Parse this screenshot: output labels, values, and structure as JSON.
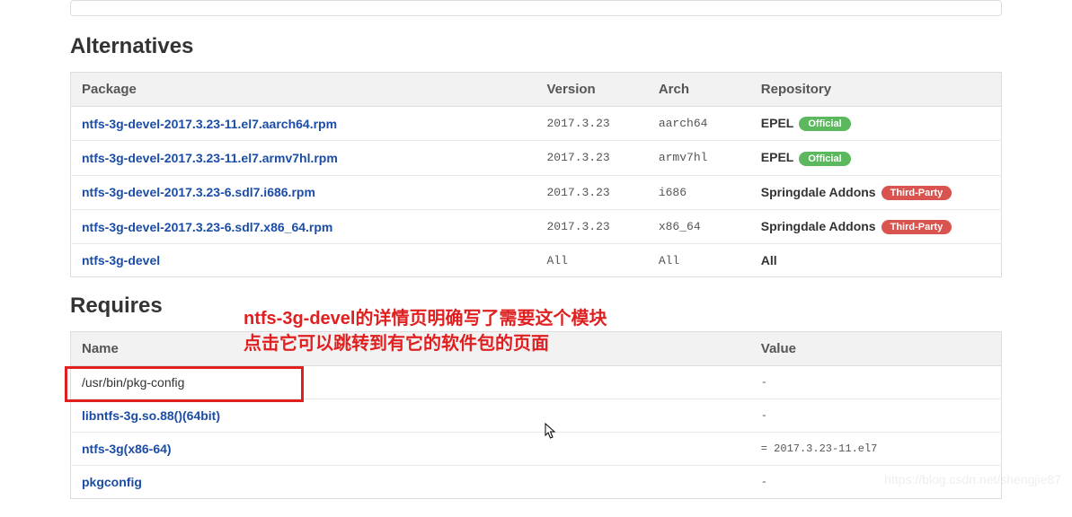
{
  "sections": {
    "alternatives": {
      "heading": "Alternatives",
      "columns": {
        "package": "Package",
        "version": "Version",
        "arch": "Arch",
        "repository": "Repository"
      },
      "rows": [
        {
          "package": "ntfs-3g-devel-2017.3.23-11.el7.aarch64.rpm",
          "version": "2017.3.23",
          "arch": "aarch64",
          "repo": "EPEL",
          "badge": "Official",
          "badge_kind": "green"
        },
        {
          "package": "ntfs-3g-devel-2017.3.23-11.el7.armv7hl.rpm",
          "version": "2017.3.23",
          "arch": "armv7hl",
          "repo": "EPEL",
          "badge": "Official",
          "badge_kind": "green"
        },
        {
          "package": "ntfs-3g-devel-2017.3.23-6.sdl7.i686.rpm",
          "version": "2017.3.23",
          "arch": "i686",
          "repo": "Springdale Addons",
          "badge": "Third-Party",
          "badge_kind": "red"
        },
        {
          "package": "ntfs-3g-devel-2017.3.23-6.sdl7.x86_64.rpm",
          "version": "2017.3.23",
          "arch": "x86_64",
          "repo": "Springdale Addons",
          "badge": "Third-Party",
          "badge_kind": "red"
        },
        {
          "package": "ntfs-3g-devel",
          "version": "All",
          "arch": "All",
          "repo": "All",
          "badge": "",
          "badge_kind": ""
        }
      ]
    },
    "requires": {
      "heading": "Requires",
      "columns": {
        "name": "Name",
        "value": "Value"
      },
      "rows": [
        {
          "name": "/usr/bin/pkg-config",
          "name_link": false,
          "value": "-"
        },
        {
          "name": "libntfs-3g.so.88()(64bit)",
          "name_link": true,
          "value": "-"
        },
        {
          "name": "ntfs-3g(x86-64)",
          "name_link": true,
          "value": "= 2017.3.23-11.el7"
        },
        {
          "name": "pkgconfig",
          "name_link": true,
          "value": "-"
        }
      ]
    }
  },
  "annotations": {
    "line1": "ntfs-3g-devel的详情页明确写了需要这个模块",
    "line2": "点击它可以跳转到有它的软件包的页面"
  },
  "watermark": "https://blog.csdn.net/shengjie87"
}
